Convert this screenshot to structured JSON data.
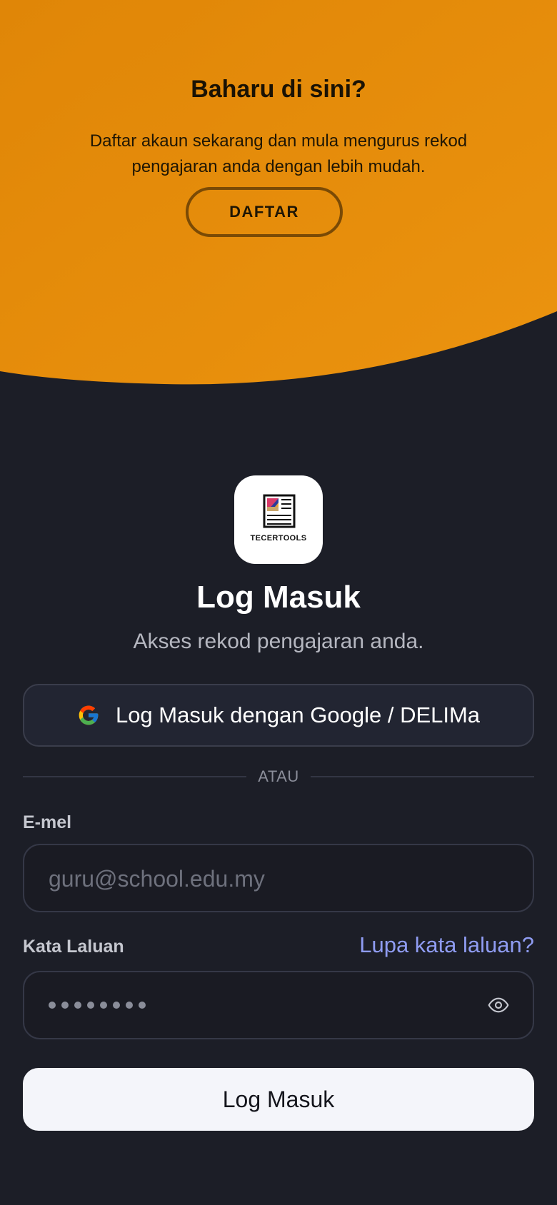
{
  "colors": {
    "background": "#1c1e27",
    "hero_orange": "#e68a0c",
    "accent_link": "#8f9cf2",
    "primary_button": "#f4f5fa"
  },
  "hero": {
    "title": "Baharu di sini?",
    "description": "Daftar akaun sekarang dan mula mengurus rekod pengajaran anda dengan lebih mudah.",
    "register_button": "DAFTAR"
  },
  "logo": {
    "text": "TECERTOOLS",
    "icon": "document-logo-icon"
  },
  "login": {
    "title": "Log Masuk",
    "subtitle": "Akses rekod pengajaran anda.",
    "google_button": "Log Masuk dengan Google / DELIMa",
    "google_icon": "google-icon",
    "divider_text": "ATAU",
    "email_label": "E-mel",
    "email_placeholder": "guru@school.edu.my",
    "email_value": "",
    "password_label": "Kata Laluan",
    "forgot_link": "Lupa kata laluan?",
    "password_masked_length": 8,
    "eye_icon": "eye-icon",
    "submit_button": "Log Masuk"
  }
}
